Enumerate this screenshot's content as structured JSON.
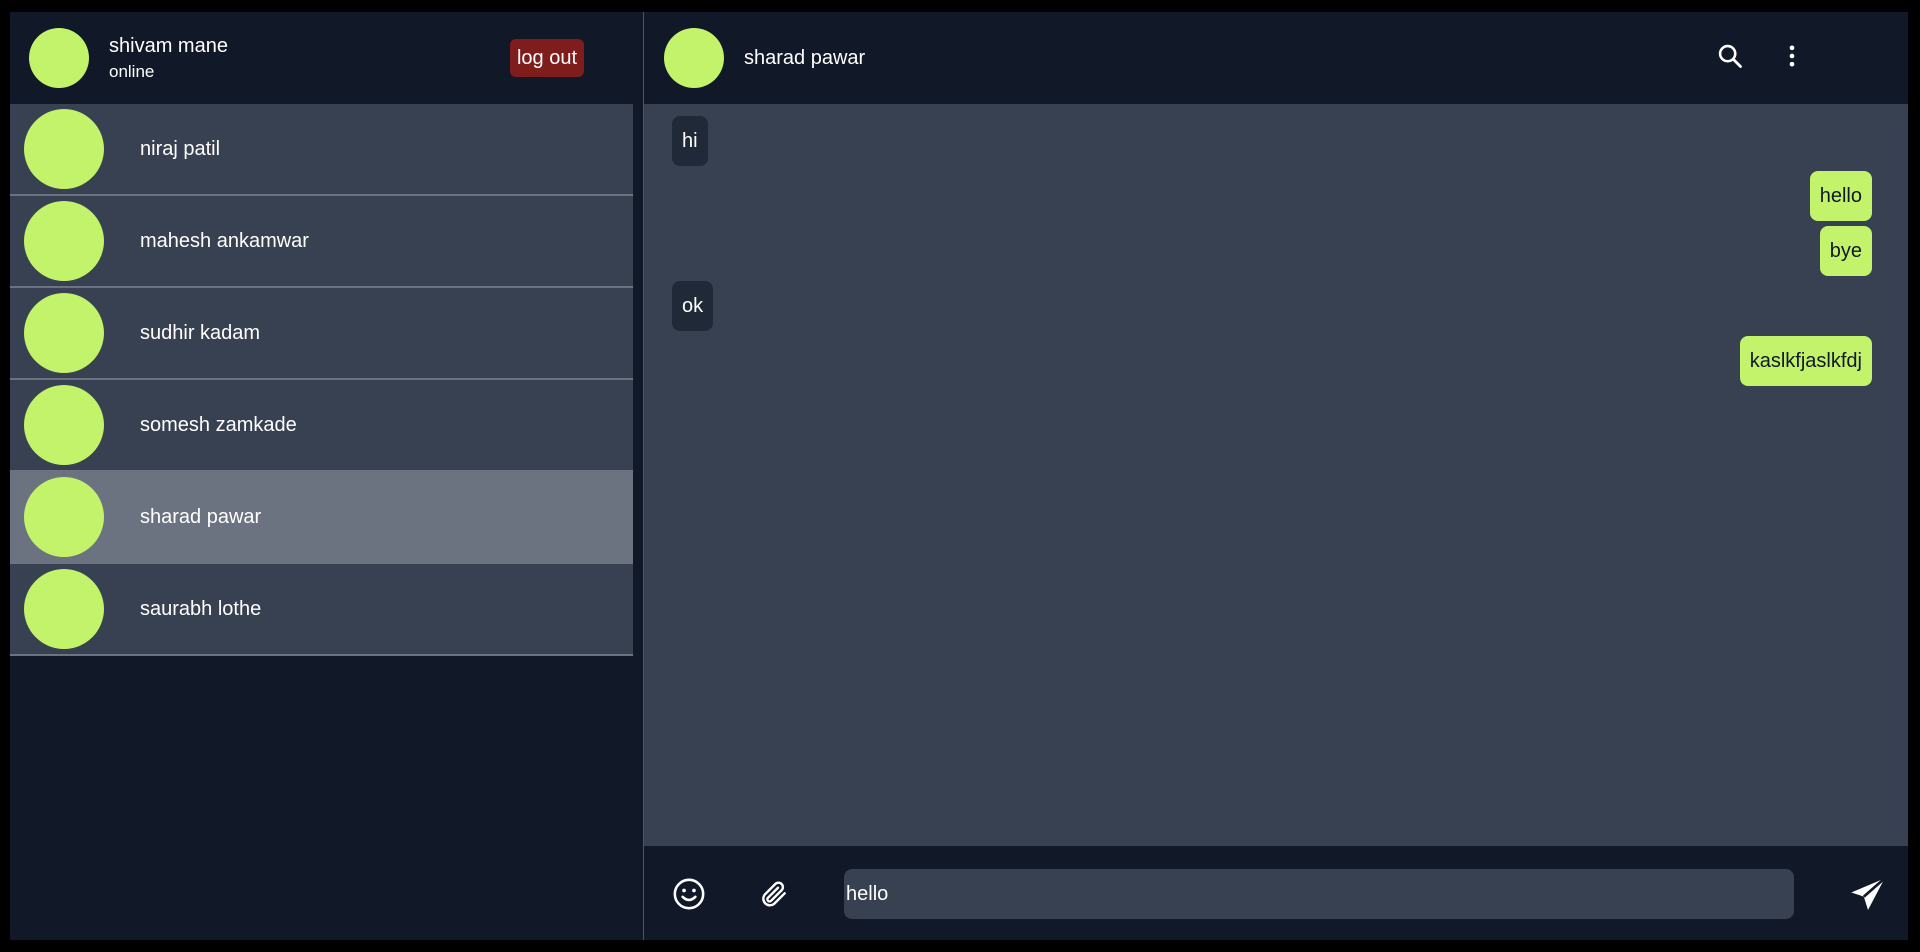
{
  "current_user": {
    "name": "shivam mane",
    "status": "online"
  },
  "logout_label": "log out",
  "contacts": [
    {
      "name": "niraj patil"
    },
    {
      "name": "mahesh ankamwar"
    },
    {
      "name": "sudhir kadam"
    },
    {
      "name": "somesh zamkade"
    },
    {
      "name": "sharad pawar"
    },
    {
      "name": "saurabh lothe"
    }
  ],
  "active_contact": "sharad pawar",
  "chat": {
    "contact_name": "sharad pawar",
    "messages": [
      {
        "text": "hi",
        "direction": "in"
      },
      {
        "text": "hello",
        "direction": "out"
      },
      {
        "text": "bye",
        "direction": "out"
      },
      {
        "text": "ok",
        "direction": "in"
      },
      {
        "text": "kaslkfjaslkfdj",
        "direction": "out"
      }
    ]
  },
  "composer": {
    "value": "hello"
  },
  "icons": {
    "search": "search-icon",
    "more": "more-vertical-icon",
    "emoji": "emoji-icon",
    "attach": "paperclip-icon",
    "send": "send-icon"
  },
  "colors": {
    "accent": "#c3f36b",
    "logout_bg": "#7f1d1d",
    "panel_bg": "#111827",
    "item_bg": "#374151",
    "active_item_bg": "#6b7280"
  }
}
